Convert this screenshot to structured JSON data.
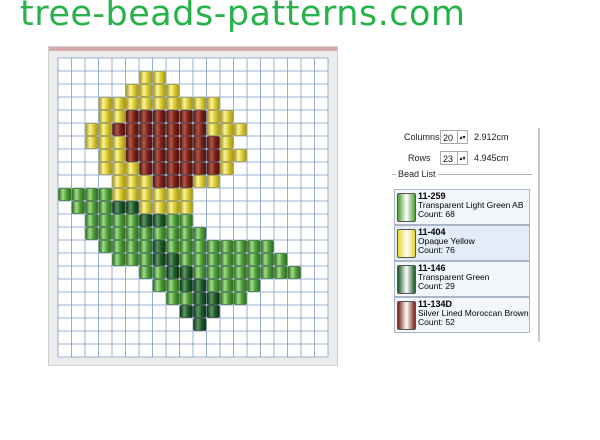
{
  "site": {
    "title": "tree-beads-patterns.com",
    "title_color": "#27b24a"
  },
  "pattern": {
    "columns": 20,
    "rows": 23,
    "legend": {
      "Y": "11-404",
      "B": "11-134D",
      "G": "11-259",
      "D": "11-146"
    },
    "grid": [
      "....................",
      "......YY............",
      ".....YYYY...........",
      "...YYYYYYYYY........",
      "...YYBBBBBBYY.......",
      "..YYBBBBBBBYYY......",
      "..YYYBBBBBBBY.......",
      "...YYBBBBBBBYY......",
      "...YYYBBBBBBY.......",
      "....YYYBBBYY........",
      "GGGGYYYYYY..........",
      ".GGGDDYYYY..........",
      "..GGGGDDGG..........",
      "..GGGGGGGGG.........",
      "...GGGGDGGGGGGGG....",
      "....GGGDDGGGGGGGG...",
      "......GGDDGGGGGGGG..",
      ".......GGDDGGGG.....",
      "........GGDDGG......",
      ".........DDD........",
      "..........D.........",
      "....................",
      "...................."
    ]
  },
  "dimensions": {
    "columns_label": "Columns",
    "columns_value": "20",
    "columns_cm": "2.912cm",
    "rows_label": "Rows",
    "rows_value": "23",
    "rows_cm": "4.945cm"
  },
  "bead_list": {
    "title": "Bead List",
    "items": [
      {
        "code": "11-259",
        "name": "Transparent Light Green AB",
        "count": "Count: 68",
        "color": "#4e9d35"
      },
      {
        "code": "11-404",
        "name": "Opaque Yellow",
        "count": "Count: 76",
        "color": "#e4d52a"
      },
      {
        "code": "11-146",
        "name": "Transparent Green",
        "count": "Count: 29",
        "color": "#1f5a26"
      },
      {
        "code": "11-134D",
        "name": "Silver Lined Moroccan Brown",
        "count": "Count: 52",
        "color": "#7a2117"
      }
    ]
  },
  "colors": {
    "Y": {
      "base": "#d9cb2e",
      "light": "#fbf3a0",
      "dark": "#a6961a"
    },
    "B": {
      "base": "#7a2117",
      "light": "#b2574a",
      "dark": "#4d130d"
    },
    "G": {
      "base": "#4e9d35",
      "light": "#a2db8c",
      "dark": "#2e6b1f"
    },
    "D": {
      "base": "#1f5a26",
      "light": "#5e9868",
      "dark": "#0f3214"
    },
    "grid_line": "#7f9dc4",
    "grid_bg": "#ffffff"
  }
}
